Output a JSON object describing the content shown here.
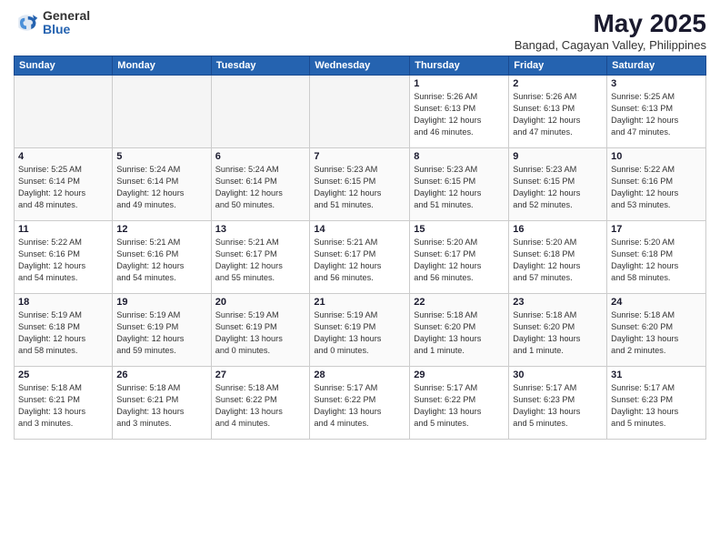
{
  "logo": {
    "general": "General",
    "blue": "Blue"
  },
  "header": {
    "title": "May 2025",
    "subtitle": "Bangad, Cagayan Valley, Philippines"
  },
  "weekdays": [
    "Sunday",
    "Monday",
    "Tuesday",
    "Wednesday",
    "Thursday",
    "Friday",
    "Saturday"
  ],
  "weeks": [
    [
      {
        "day": "",
        "info": ""
      },
      {
        "day": "",
        "info": ""
      },
      {
        "day": "",
        "info": ""
      },
      {
        "day": "",
        "info": ""
      },
      {
        "day": "1",
        "info": "Sunrise: 5:26 AM\nSunset: 6:13 PM\nDaylight: 12 hours\nand 46 minutes."
      },
      {
        "day": "2",
        "info": "Sunrise: 5:26 AM\nSunset: 6:13 PM\nDaylight: 12 hours\nand 47 minutes."
      },
      {
        "day": "3",
        "info": "Sunrise: 5:25 AM\nSunset: 6:13 PM\nDaylight: 12 hours\nand 47 minutes."
      }
    ],
    [
      {
        "day": "4",
        "info": "Sunrise: 5:25 AM\nSunset: 6:14 PM\nDaylight: 12 hours\nand 48 minutes."
      },
      {
        "day": "5",
        "info": "Sunrise: 5:24 AM\nSunset: 6:14 PM\nDaylight: 12 hours\nand 49 minutes."
      },
      {
        "day": "6",
        "info": "Sunrise: 5:24 AM\nSunset: 6:14 PM\nDaylight: 12 hours\nand 50 minutes."
      },
      {
        "day": "7",
        "info": "Sunrise: 5:23 AM\nSunset: 6:15 PM\nDaylight: 12 hours\nand 51 minutes."
      },
      {
        "day": "8",
        "info": "Sunrise: 5:23 AM\nSunset: 6:15 PM\nDaylight: 12 hours\nand 51 minutes."
      },
      {
        "day": "9",
        "info": "Sunrise: 5:23 AM\nSunset: 6:15 PM\nDaylight: 12 hours\nand 52 minutes."
      },
      {
        "day": "10",
        "info": "Sunrise: 5:22 AM\nSunset: 6:16 PM\nDaylight: 12 hours\nand 53 minutes."
      }
    ],
    [
      {
        "day": "11",
        "info": "Sunrise: 5:22 AM\nSunset: 6:16 PM\nDaylight: 12 hours\nand 54 minutes."
      },
      {
        "day": "12",
        "info": "Sunrise: 5:21 AM\nSunset: 6:16 PM\nDaylight: 12 hours\nand 54 minutes."
      },
      {
        "day": "13",
        "info": "Sunrise: 5:21 AM\nSunset: 6:17 PM\nDaylight: 12 hours\nand 55 minutes."
      },
      {
        "day": "14",
        "info": "Sunrise: 5:21 AM\nSunset: 6:17 PM\nDaylight: 12 hours\nand 56 minutes."
      },
      {
        "day": "15",
        "info": "Sunrise: 5:20 AM\nSunset: 6:17 PM\nDaylight: 12 hours\nand 56 minutes."
      },
      {
        "day": "16",
        "info": "Sunrise: 5:20 AM\nSunset: 6:18 PM\nDaylight: 12 hours\nand 57 minutes."
      },
      {
        "day": "17",
        "info": "Sunrise: 5:20 AM\nSunset: 6:18 PM\nDaylight: 12 hours\nand 58 minutes."
      }
    ],
    [
      {
        "day": "18",
        "info": "Sunrise: 5:19 AM\nSunset: 6:18 PM\nDaylight: 12 hours\nand 58 minutes."
      },
      {
        "day": "19",
        "info": "Sunrise: 5:19 AM\nSunset: 6:19 PM\nDaylight: 12 hours\nand 59 minutes."
      },
      {
        "day": "20",
        "info": "Sunrise: 5:19 AM\nSunset: 6:19 PM\nDaylight: 13 hours\nand 0 minutes."
      },
      {
        "day": "21",
        "info": "Sunrise: 5:19 AM\nSunset: 6:19 PM\nDaylight: 13 hours\nand 0 minutes."
      },
      {
        "day": "22",
        "info": "Sunrise: 5:18 AM\nSunset: 6:20 PM\nDaylight: 13 hours\nand 1 minute."
      },
      {
        "day": "23",
        "info": "Sunrise: 5:18 AM\nSunset: 6:20 PM\nDaylight: 13 hours\nand 1 minute."
      },
      {
        "day": "24",
        "info": "Sunrise: 5:18 AM\nSunset: 6:20 PM\nDaylight: 13 hours\nand 2 minutes."
      }
    ],
    [
      {
        "day": "25",
        "info": "Sunrise: 5:18 AM\nSunset: 6:21 PM\nDaylight: 13 hours\nand 3 minutes."
      },
      {
        "day": "26",
        "info": "Sunrise: 5:18 AM\nSunset: 6:21 PM\nDaylight: 13 hours\nand 3 minutes."
      },
      {
        "day": "27",
        "info": "Sunrise: 5:18 AM\nSunset: 6:22 PM\nDaylight: 13 hours\nand 4 minutes."
      },
      {
        "day": "28",
        "info": "Sunrise: 5:17 AM\nSunset: 6:22 PM\nDaylight: 13 hours\nand 4 minutes."
      },
      {
        "day": "29",
        "info": "Sunrise: 5:17 AM\nSunset: 6:22 PM\nDaylight: 13 hours\nand 5 minutes."
      },
      {
        "day": "30",
        "info": "Sunrise: 5:17 AM\nSunset: 6:23 PM\nDaylight: 13 hours\nand 5 minutes."
      },
      {
        "day": "31",
        "info": "Sunrise: 5:17 AM\nSunset: 6:23 PM\nDaylight: 13 hours\nand 5 minutes."
      }
    ]
  ]
}
